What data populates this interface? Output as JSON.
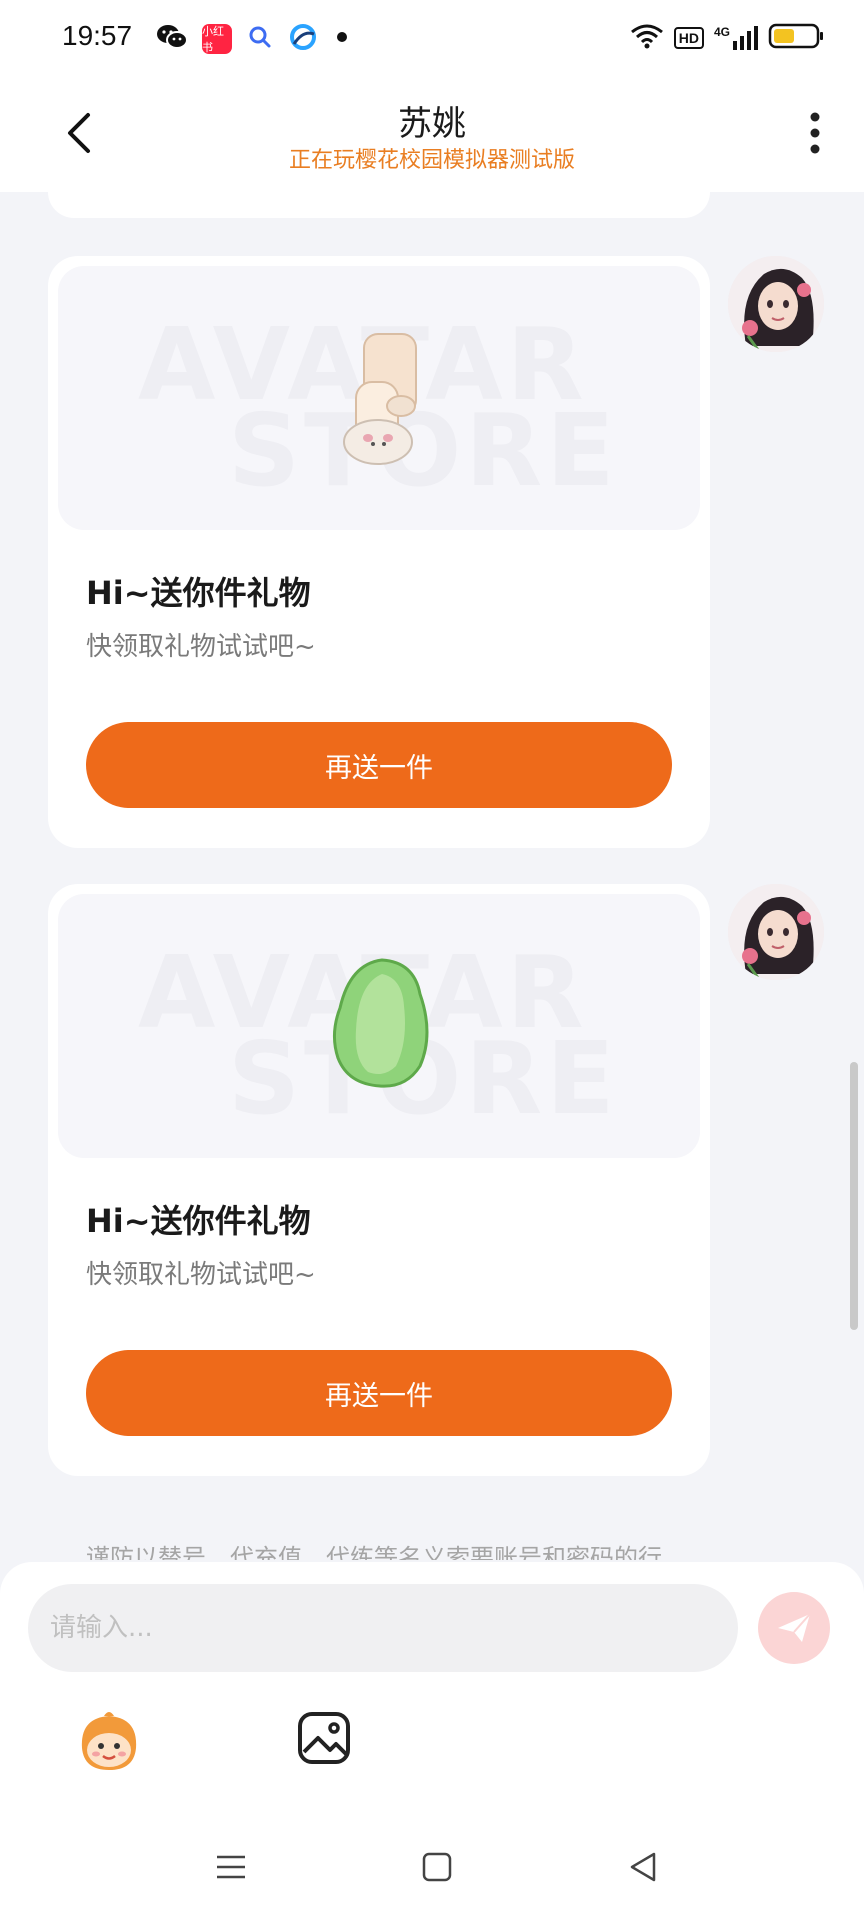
{
  "status": {
    "time": "19:57",
    "apps": [
      {
        "name": "wechat-icon",
        "color": "#1a1a1a"
      },
      {
        "name": "xiaohongshu-icon",
        "color": "#ff2442",
        "text": "小红书"
      },
      {
        "name": "search-app-icon",
        "color": "#3d6cf2"
      },
      {
        "name": "browser-app-icon",
        "color": "#2aa3ff"
      }
    ],
    "hd": "HD",
    "network": "4G"
  },
  "header": {
    "title": "苏姚",
    "subtitle": "正在玩樱花校园模拟器测试版"
  },
  "messages": [
    {
      "type": "gift",
      "gift_icon": "socks-gift-icon",
      "watermark_top": "AVATAR",
      "watermark_bottom": "STORE",
      "title": "Hi~送你件礼物",
      "subtitle": "快领取礼物试试吧~",
      "button": "再送一件"
    },
    {
      "type": "gift",
      "gift_icon": "jade-gift-icon",
      "watermark_top": "AVATAR",
      "watermark_bottom": "STORE",
      "title": "Hi~送你件礼物",
      "subtitle": "快领取礼物试试吧~",
      "button": "再送一件"
    }
  ],
  "notice": "谨防以替号、代充值、代练等名义索要账号和密码的行",
  "input": {
    "placeholder": "请输入..."
  },
  "colors": {
    "accent": "#ee6a1a",
    "subtitle": "#e97e22",
    "send_button": "#fbd5d5"
  }
}
